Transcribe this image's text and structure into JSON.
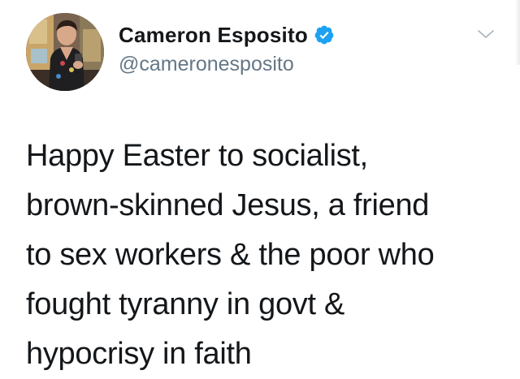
{
  "tweet": {
    "author": {
      "display_name": "Cameron Esposito",
      "handle": "@cameronesposito",
      "verified": true,
      "avatar_icon": "profile-photo"
    },
    "menu_icon": "chevron-down-icon",
    "text_lines": [
      "Happy Easter to socialist,",
      "brown-skinned Jesus, a friend",
      "to sex workers & the poor who",
      "fought tyranny in govt &",
      "hypocrisy in faith"
    ]
  },
  "colors": {
    "text": "#14171a",
    "secondary": "#657786",
    "verified_blue": "#1da1f2",
    "caret": "#aab8c2"
  }
}
